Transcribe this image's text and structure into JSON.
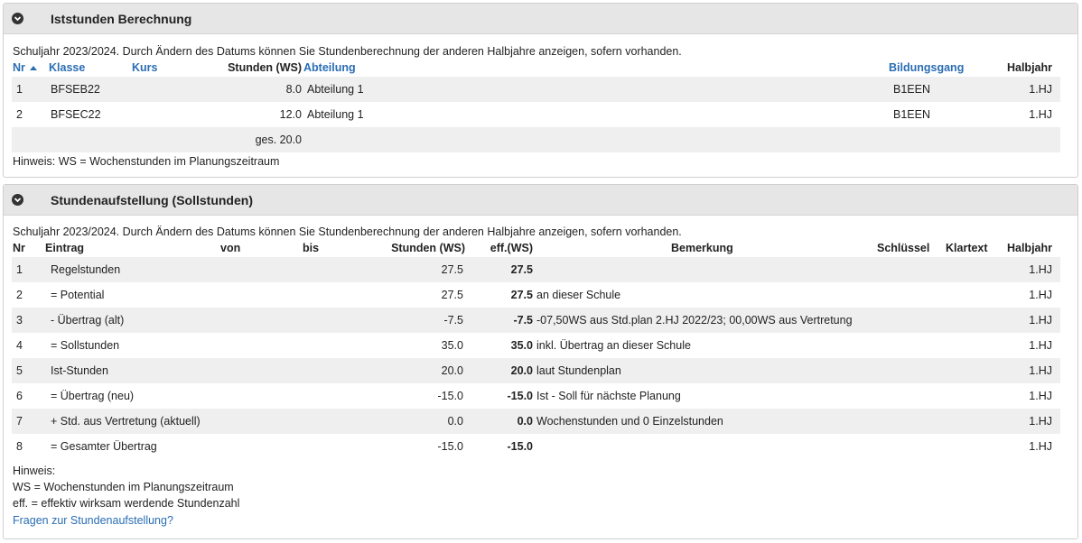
{
  "panel1": {
    "title": "Iststunden Berechnung",
    "intro": "Schuljahr 2023/2024. Durch Ändern des Datums können Sie Stundenberechnung der anderen Halbjahre anzeigen, sofern vorhanden.",
    "headers": {
      "nr": "Nr",
      "klasse": "Klasse",
      "kurs": "Kurs",
      "stunden": "Stunden (WS)",
      "abteilung": "Abteilung",
      "bildungsgang": "Bildungsgang",
      "halbjahr": "Halbjahr"
    },
    "rows": [
      {
        "nr": "1",
        "klasse": "BFSEB22",
        "kurs": "",
        "stunden": "8.0",
        "abteilung": "Abteilung 1",
        "bildungsgang": "B1EEN",
        "halbjahr": "1.HJ"
      },
      {
        "nr": "2",
        "klasse": "BFSEC22",
        "kurs": "",
        "stunden": "12.0",
        "abteilung": "Abteilung 1",
        "bildungsgang": "B1EEN",
        "halbjahr": "1.HJ"
      }
    ],
    "total": "ges. 20.0",
    "hint": "Hinweis: WS = Wochenstunden im Planungszeitraum"
  },
  "panel2": {
    "title": "Stundenaufstellung (Sollstunden)",
    "intro": "Schuljahr 2023/2024. Durch Ändern des Datums können Sie Stundenberechnung der anderen Halbjahre anzeigen, sofern vorhanden.",
    "headers": {
      "nr": "Nr",
      "eintrag": "Eintrag",
      "von": "von",
      "bis": "bis",
      "stunden": "Stunden (WS)",
      "eff": "eff.(WS)",
      "bemerkung": "Bemerkung",
      "schluessel": "Schlüssel",
      "klartext": "Klartext",
      "halbjahr": "Halbjahr"
    },
    "rows": [
      {
        "nr": "1",
        "eintrag": "Regelstunden",
        "stunden": "27.5",
        "eff": "27.5",
        "bemerkung": "",
        "halbjahr": "1.HJ"
      },
      {
        "nr": "2",
        "eintrag": "= Potential",
        "stunden": "27.5",
        "eff": "27.5",
        "bemerkung": "an dieser Schule",
        "halbjahr": "1.HJ"
      },
      {
        "nr": "3",
        "eintrag": "- Übertrag (alt)",
        "stunden": "-7.5",
        "eff": "-7.5",
        "bemerkung": "-07,50WS aus Std.plan 2.HJ 2022/23; 00,00WS aus Vertretung",
        "halbjahr": "1.HJ"
      },
      {
        "nr": "4",
        "eintrag": "= Sollstunden",
        "stunden": "35.0",
        "eff": "35.0",
        "bemerkung": "inkl. Übertrag an dieser Schule",
        "halbjahr": "1.HJ"
      },
      {
        "nr": "5",
        "eintrag": "Ist-Stunden",
        "stunden": "20.0",
        "eff": "20.0",
        "bemerkung": "laut Stundenplan",
        "halbjahr": "1.HJ"
      },
      {
        "nr": "6",
        "eintrag": "= Übertrag (neu)",
        "stunden": "-15.0",
        "eff": "-15.0",
        "bemerkung": "Ist - Soll für nächste Planung",
        "halbjahr": "1.HJ"
      },
      {
        "nr": "7",
        "eintrag": "+ Std. aus Vertretung (aktuell)",
        "stunden": "0.0",
        "eff": "0.0",
        "bemerkung": "Wochenstunden und 0 Einzelstunden",
        "halbjahr": "1.HJ"
      },
      {
        "nr": "8",
        "eintrag": "= Gesamter Übertrag",
        "stunden": "-15.0",
        "eff": "-15.0",
        "bemerkung": "",
        "halbjahr": "1.HJ"
      }
    ],
    "hint_title": "Hinweis:",
    "hint_ws": "WS = Wochenstunden im Planungszeitraum",
    "hint_eff": "eff. = effektiv wirksam werdende Stundenzahl",
    "help_link": "Fragen zur Stundenaufstellung?"
  }
}
